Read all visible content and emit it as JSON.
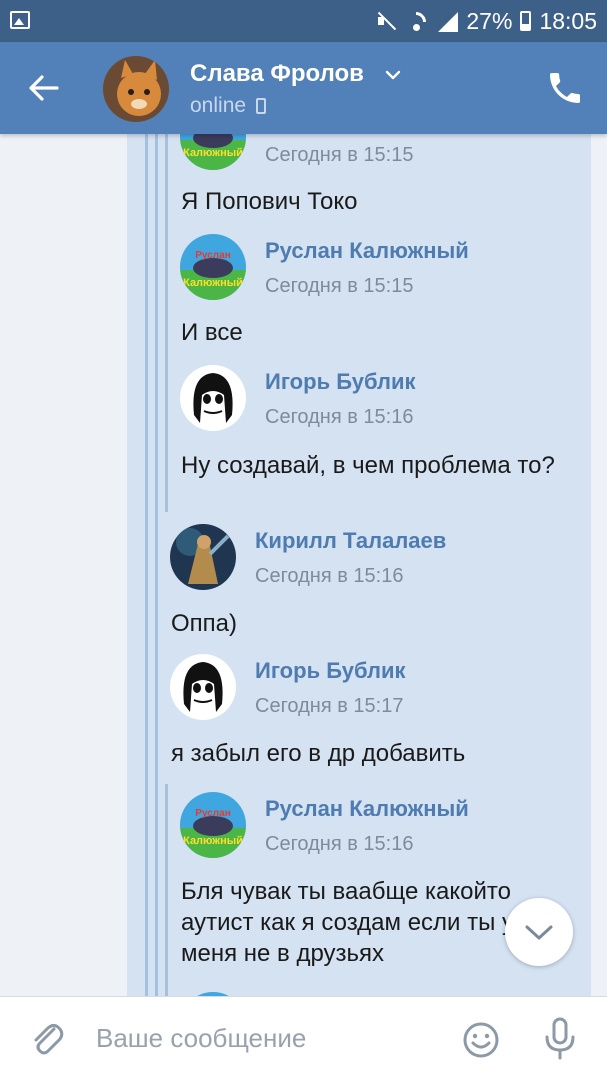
{
  "status_bar": {
    "battery": "27%",
    "time": "18:05"
  },
  "header": {
    "title": "Слава Фролов",
    "status": "online"
  },
  "messages": [
    {
      "name": "",
      "time": "Сегодня в 15:15",
      "text": "Я Попович Токо",
      "avatar": "ruslan"
    },
    {
      "name": "Руслан Калюжный",
      "time": "Сегодня в 15:15",
      "text": "И все",
      "avatar": "ruslan"
    },
    {
      "name": "Игорь Бублик",
      "time": "Сегодня в 15:16",
      "text": "Ну создавай, в чем проблема то?",
      "avatar": "igor"
    },
    {
      "name": "Кирилл Талалаев",
      "time": "Сегодня в 15:16",
      "text": "Оппа)",
      "avatar": "kirill"
    },
    {
      "name": "Игорь Бублик",
      "time": "Сегодня в 15:17",
      "text": "я забыл его в др добавить",
      "avatar": "igor"
    },
    {
      "name": "Руслан Калюжный",
      "time": "Сегодня в 15:16",
      "text": "Бля чувак ты ваабще какойто аутист как я создам если ты у меня не в друзьях",
      "avatar": "ruslan"
    }
  ],
  "composer": {
    "placeholder": "Ваше сообщение"
  },
  "colors": {
    "status_bar": "#3d6089",
    "header": "#5181b8",
    "message_bg": "#d4e2f2",
    "author_name": "#4e7bb0"
  }
}
